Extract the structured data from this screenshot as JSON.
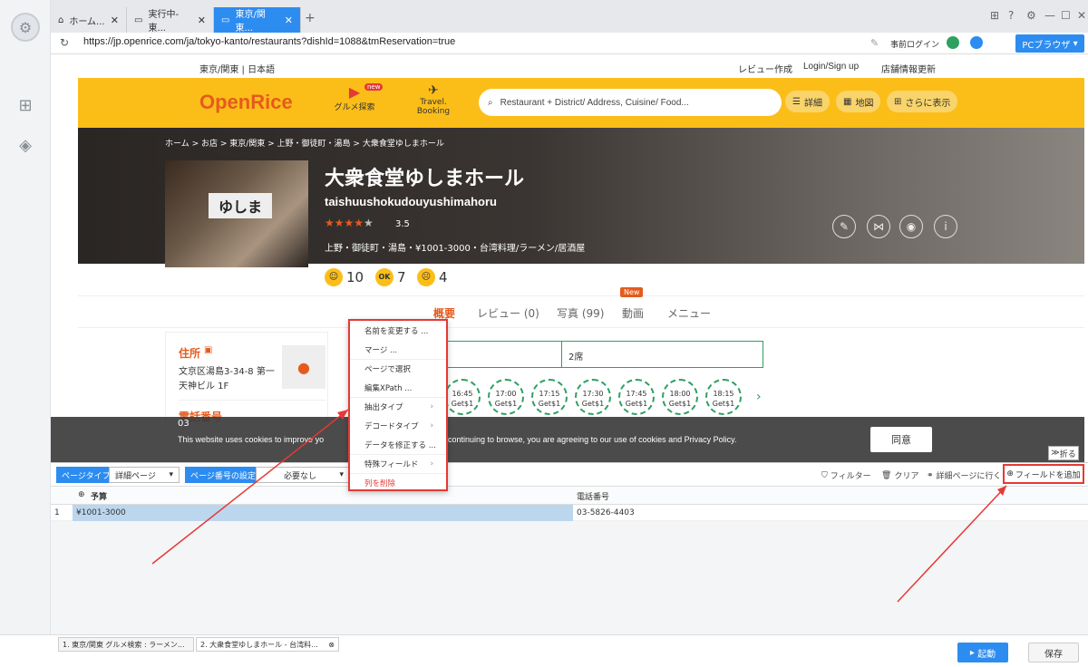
{
  "browser": {
    "tabs": [
      {
        "label": "ホーム..."
      },
      {
        "label": "実行中-東..."
      },
      {
        "label": "東京/関東..."
      }
    ],
    "url": "https://jp.openrice.com/ja/tokyo-kanto/restaurants?dishId=1088&tmReservation=true",
    "preorder_login": "事前ログイン",
    "pc_browser": "PCブラウザ"
  },
  "site": {
    "region": "東京/関東 | 日本語",
    "review_link": "レビュー作成",
    "login_link": "Login/Sign up",
    "shop_update": "店舗情報更新",
    "logo": "OpenRice",
    "gourmet": "グルメ探索",
    "gourmet_badge": "new",
    "travel": "Travel.",
    "booking": "Booking",
    "search_placeholder": "Restaurant + District/ Address, Cuisine/ Food...",
    "btn_detail": "詳細",
    "btn_map": "地図",
    "btn_more": "さらに表示"
  },
  "restaurant": {
    "breadcrumb": "ホーム  >  お店  >  東京/関東  >  上野・御徒町・湯島  >  大衆食堂ゆしまホール",
    "name": "大衆食堂ゆしまホール",
    "romaji": "taishuushokudouyushimahoru",
    "rating": "3.5",
    "meta": "上野・御徒町・湯島・¥1001-3000・台湾料理/ラーメン/居酒屋",
    "sign": "ゆしま",
    "smile_count": "10",
    "ok_count": "7",
    "sad_count": "4"
  },
  "page_tabs": {
    "overview": "概要",
    "reviews": "レビュー (0)",
    "photos": "写真 (99)",
    "video": "動画",
    "video_badge": "New",
    "menu": "メニュー"
  },
  "info": {
    "address_title": "住所",
    "address": "文京区湯島3-34-8 第一天神ビル 1F",
    "phone_title": "電話番号",
    "phone_partial": "03",
    "seats": "2席",
    "slots": [
      {
        "time": "16:45",
        "label": "Get$1"
      },
      {
        "time": "17:00",
        "label": "Get$1"
      },
      {
        "time": "17:15",
        "label": "Get$1"
      },
      {
        "time": "17:30",
        "label": "Get$1"
      },
      {
        "time": "17:45",
        "label": "Get$1"
      },
      {
        "time": "18:00",
        "label": "Get$1"
      },
      {
        "time": "18:15",
        "label": "Get$1"
      }
    ]
  },
  "cookie": {
    "text_left": "This website uses cookies to improve yo",
    "text_right": "continuing to browse, you are agreeing to our use of cookies and Privacy Policy.",
    "agree": "同意",
    "fold": "折る"
  },
  "context_menu": {
    "items": [
      {
        "label": "名前を変更する ..."
      },
      {
        "label": "マージ ..."
      },
      {
        "label": "ページで選択"
      },
      {
        "label": "編集XPath ..."
      },
      {
        "label": "抽出タイプ"
      },
      {
        "label": "デコードタイプ"
      },
      {
        "label": "データを修正する ..."
      },
      {
        "label": "特殊フィールド"
      },
      {
        "label": "列を削除"
      }
    ]
  },
  "panel": {
    "page_type_label": "ページタイプ",
    "page_type_value": "詳細ページ",
    "page_num_label": "ページ番号の設定",
    "page_num_value": "必要なし",
    "filter": "フィルター",
    "clear": "クリア",
    "go_detail": "詳細ページに行く",
    "add_field": "フィールドを追加",
    "col1": "予算",
    "col2": "電話番号",
    "row_index": "1",
    "row_budget": "¥1001-3000",
    "row_phone": "03-5826-4403"
  },
  "bottom": {
    "tab1": "1. 東京/関東 グルメ検索 : ラーメン...",
    "tab2": "2. 大衆食堂ゆしまホール - 台湾料...",
    "run": "起動",
    "save": "保存"
  }
}
